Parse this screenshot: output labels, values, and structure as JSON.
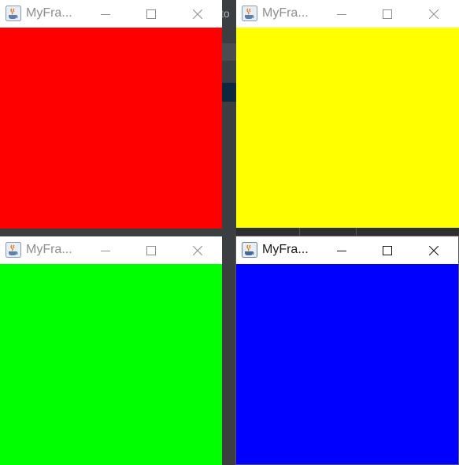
{
  "background": {
    "ide_fragment_text": "to"
  },
  "windows": [
    {
      "id": "window-red",
      "title": "MyFra...",
      "active": false,
      "content_color": "#ff0000",
      "content_color_name": "red"
    },
    {
      "id": "window-yellow",
      "title": "MyFra...",
      "active": false,
      "content_color": "#ffff00",
      "content_color_name": "yellow"
    },
    {
      "id": "window-green",
      "title": "MyFra...",
      "active": false,
      "content_color": "#00ff00",
      "content_color_name": "green"
    },
    {
      "id": "window-blue",
      "title": "MyFra...",
      "active": true,
      "content_color": "#0000ff",
      "content_color_name": "blue"
    }
  ],
  "controls": {
    "minimize_icon": "minimize-icon",
    "maximize_icon": "maximize-icon",
    "close_icon": "close-icon",
    "app_icon": "java-coffee-cup-icon"
  }
}
